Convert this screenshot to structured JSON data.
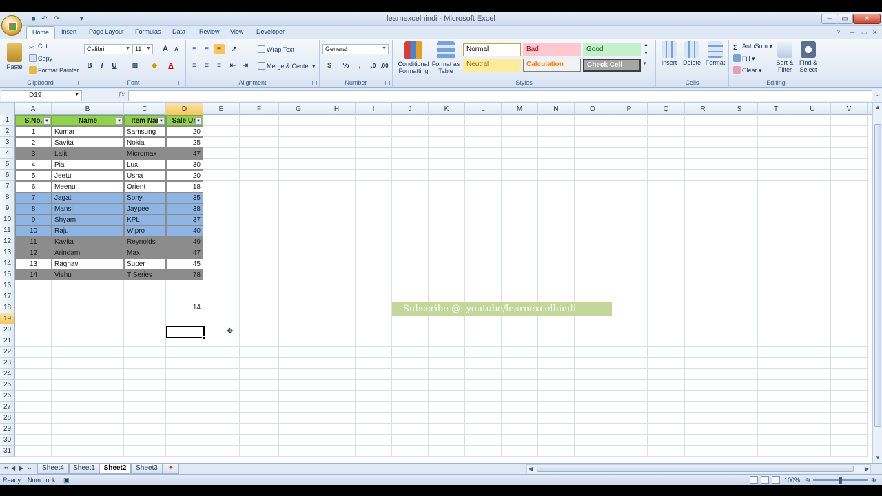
{
  "window": {
    "title": "learnexcelhindi - Microsoft Excel",
    "minimize": "─",
    "maximize": "▭",
    "close": "✕"
  },
  "ribbon_tabs": [
    "Home",
    "Insert",
    "Page Layout",
    "Formulas",
    "Data",
    "Review",
    "View",
    "Developer"
  ],
  "ribbon": {
    "clipboard": {
      "label": "Clipboard",
      "paste": "Paste",
      "cut": "Cut",
      "copy": "Copy",
      "format_painter": "Format Painter"
    },
    "font": {
      "label": "Font",
      "font_name": "Calibri",
      "font_size": "11",
      "bold": "B",
      "italic": "I",
      "underline": "U",
      "grow": "A",
      "shrink": "A"
    },
    "alignment": {
      "label": "Alignment",
      "wrap_text": "Wrap Text",
      "merge_center": "Merge & Center"
    },
    "number": {
      "label": "Number",
      "format": "General",
      "percent": "%"
    },
    "styles": {
      "label": "Styles",
      "conditional_formatting": "Conditional Formatting",
      "format_as_table": "Format as Table",
      "normal": "Normal",
      "bad": "Bad",
      "good": "Good",
      "neutral": "Neutral",
      "calculation": "Calculation",
      "check_cell": "Check Cell"
    },
    "cells": {
      "label": "Cells",
      "insert": "Insert",
      "delete": "Delete",
      "format": "Format"
    },
    "editing": {
      "label": "Editing",
      "autosum": "AutoSum",
      "fill": "Fill",
      "clear": "Clear",
      "sort_filter": "Sort & Filter",
      "find_select": "Find & Select"
    }
  },
  "formula_bar": {
    "name_box": "D19",
    "fx": "fx",
    "formula": ""
  },
  "columns": [
    "A",
    "B",
    "C",
    "D",
    "E",
    "F",
    "G",
    "H",
    "I",
    "J",
    "K",
    "L",
    "M",
    "N",
    "O",
    "P",
    "Q",
    "R",
    "S",
    "T",
    "U",
    "V"
  ],
  "selected_column": "D",
  "rows": [
    "1",
    "2",
    "3",
    "4",
    "5",
    "6",
    "7",
    "8",
    "9",
    "10",
    "11",
    "12",
    "13",
    "14",
    "15",
    "16",
    "17",
    "18",
    "19",
    "20",
    "21",
    "22",
    "23",
    "24",
    "25",
    "26",
    "27",
    "28",
    "29",
    "30",
    "31"
  ],
  "selected_row": "19",
  "table": {
    "headers": [
      "S.No.",
      "Name",
      "Item Nar",
      "Sale Un"
    ],
    "rows": [
      {
        "sno": "1",
        "name": "Kumar",
        "item": "Samsung",
        "sale": "20",
        "band": "white"
      },
      {
        "sno": "2",
        "name": "Savita",
        "item": "Nokia",
        "sale": "25",
        "band": "white"
      },
      {
        "sno": "3",
        "name": "Lalit",
        "item": "Micromax",
        "sale": "47",
        "band": "gray"
      },
      {
        "sno": "4",
        "name": "Pia",
        "item": "Lux",
        "sale": "30",
        "band": "white"
      },
      {
        "sno": "5",
        "name": "Jeetu",
        "item": "Usha",
        "sale": "20",
        "band": "white"
      },
      {
        "sno": "6",
        "name": "Meenu",
        "item": "Orient",
        "sale": "18",
        "band": "white"
      },
      {
        "sno": "7",
        "name": "Jagat",
        "item": "Sony",
        "sale": "35",
        "band": "blue"
      },
      {
        "sno": "8",
        "name": "Mansi",
        "item": "Jaypee",
        "sale": "38",
        "band": "blue"
      },
      {
        "sno": "9",
        "name": "Shyam",
        "item": "KPL",
        "sale": "37",
        "band": "blue"
      },
      {
        "sno": "10",
        "name": "Raju",
        "item": "Wipro",
        "sale": "40",
        "band": "blue"
      },
      {
        "sno": "11",
        "name": "Kavita",
        "item": "Reynolds",
        "sale": "49",
        "band": "gray"
      },
      {
        "sno": "12",
        "name": "Arindam",
        "item": "Max",
        "sale": "47",
        "band": "gray"
      },
      {
        "sno": "13",
        "name": "Raghav",
        "item": "Super",
        "sale": "45",
        "band": "white"
      },
      {
        "sno": "14",
        "name": "Vishu",
        "item": "T Series",
        "sale": "78",
        "band": "gray"
      }
    ]
  },
  "cell_d18": "14",
  "subscribe_banner": "Subscribe @: youtube/learnexcelhindi",
  "sheets": [
    "Sheet4",
    "Sheet1",
    "Sheet2",
    "Sheet3"
  ],
  "active_sheet": "Sheet2",
  "status": {
    "ready": "Ready",
    "num_lock": "Num Lock",
    "zoom": "100%"
  },
  "colors": {
    "header_green": "#92d050",
    "band_gray": "#8c8c8c",
    "band_blue": "#8db4e2",
    "banner": "#c4d79b"
  }
}
